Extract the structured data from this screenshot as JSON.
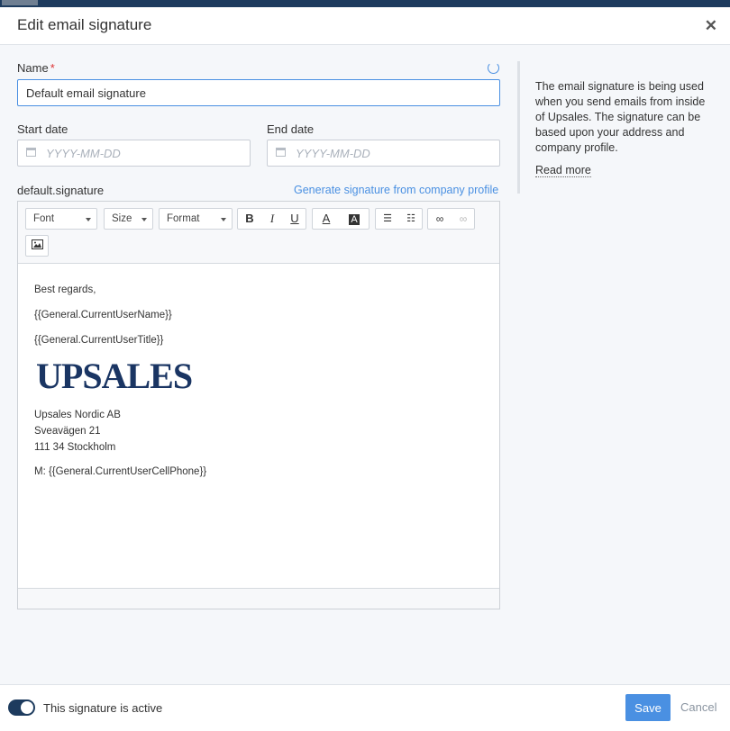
{
  "window": {
    "title": "Edit email signature"
  },
  "form": {
    "name_label": "Name",
    "name_required": "*",
    "name_value": "Default email signature",
    "start_label": "Start date",
    "start_placeholder": "YYYY-MM-DD",
    "end_label": "End date",
    "end_placeholder": "YYYY-MM-DD",
    "signature_label": "default.signature",
    "generate_link": "Generate signature from company profile"
  },
  "toolbar": {
    "font": "Font",
    "size": "Size",
    "format": "Format",
    "bold": "B",
    "italic": "I",
    "underline": "U",
    "text_color": "A",
    "bg_color": "A"
  },
  "signature": {
    "greeting": "Best regards,",
    "name_tag": "{{General.CurrentUserName}}",
    "title_tag": "{{General.CurrentUserTitle}}",
    "logo_text": "UPSALES",
    "company": "Upsales Nordic AB",
    "street": "Sveavägen 21",
    "city": "111 34 Stockholm",
    "phone": "M: {{General.CurrentUserCellPhone}}"
  },
  "help": {
    "text": "The email signature is being used when you send emails from inside of Upsales. The signature can be based upon your address and company profile.",
    "read_more": "Read more"
  },
  "footer": {
    "toggle_label": "This signature is active",
    "save": "Save",
    "cancel": "Cancel"
  },
  "colors": {
    "accent": "#4a90e2",
    "navy": "#1d3b5e",
    "logo": "#1a3563"
  }
}
